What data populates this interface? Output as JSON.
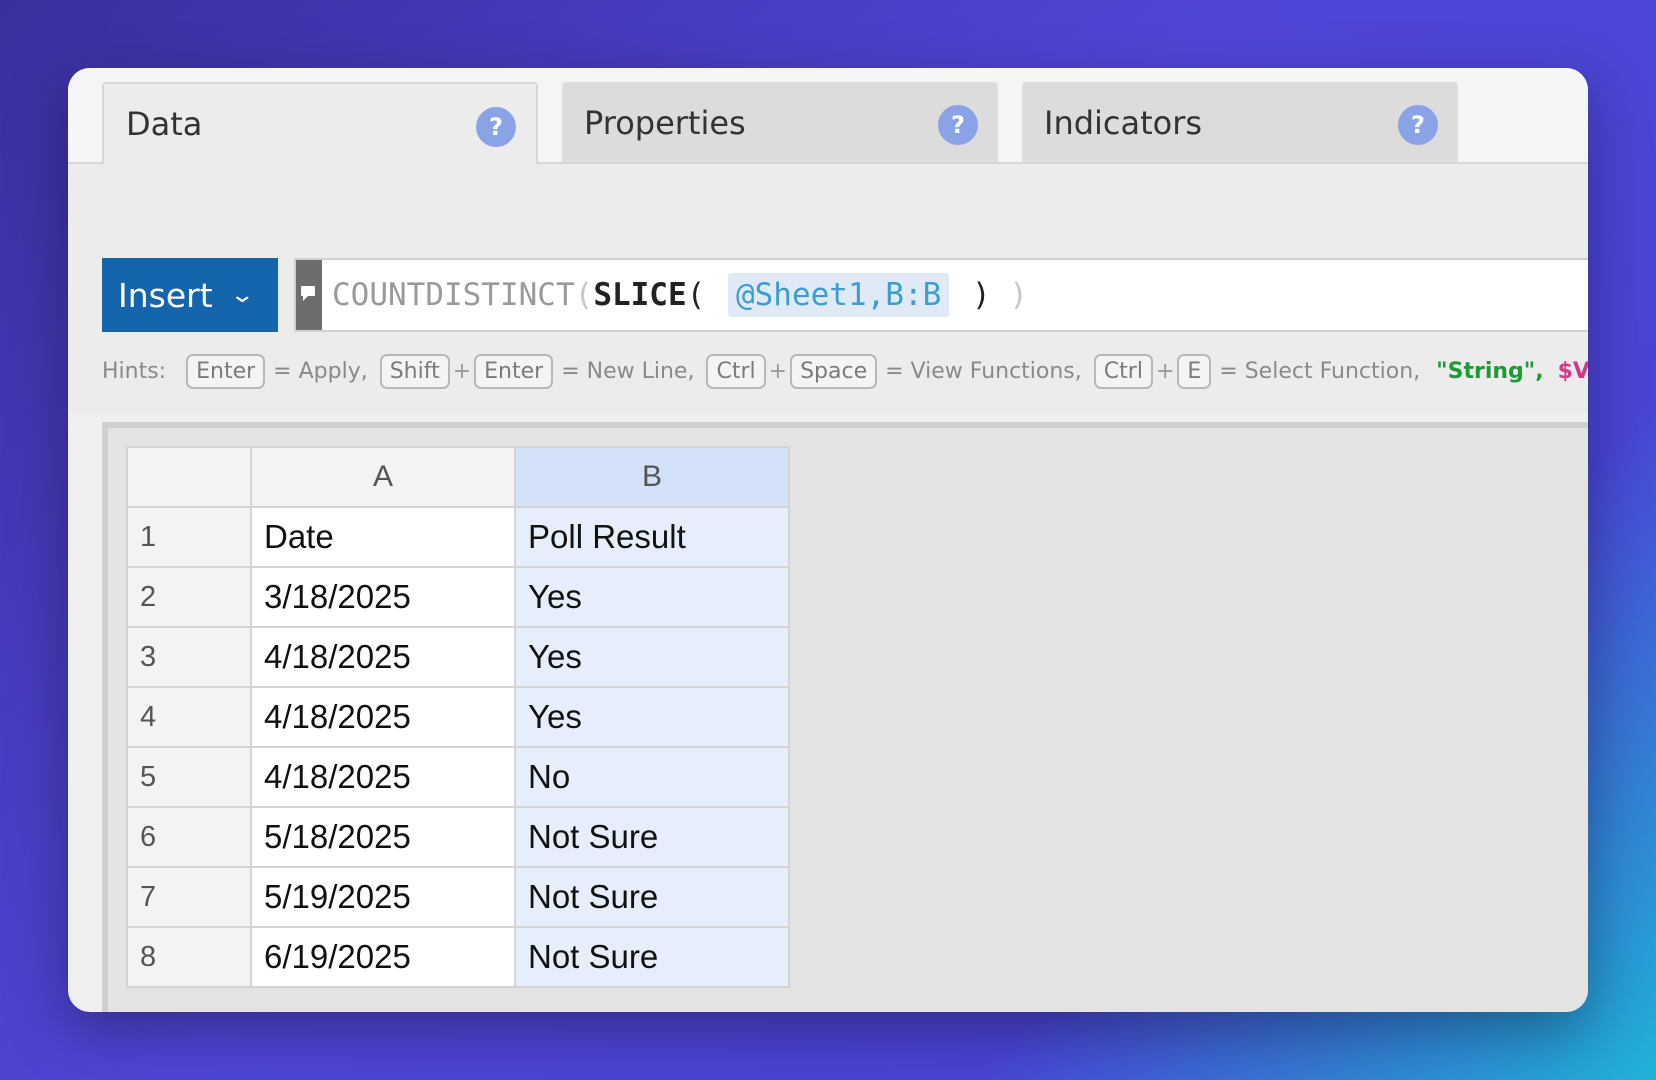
{
  "tabs": [
    {
      "label": "Data",
      "help": "?"
    },
    {
      "label": "Properties",
      "help": "?"
    },
    {
      "label": "Indicators",
      "help": "?"
    }
  ],
  "insert": {
    "label": "Insert",
    "chevron": "⌄"
  },
  "formula": {
    "fn_outer": "COUNTDISTINCT",
    "open1": "(",
    "fn_inner": "SLICE",
    "open2": "( ",
    "ref": "@Sheet1,B:B",
    "close2": " )",
    "close1": " )"
  },
  "hints": {
    "label": "Hints:",
    "keys": {
      "enter1": "Enter",
      "shift": "Shift",
      "enter2": "Enter",
      "ctrl1": "Ctrl",
      "space": "Space",
      "ctrl2": "Ctrl",
      "e": "E"
    },
    "plus": "+",
    "apply": "= Apply,",
    "new_line": "= New Line,",
    "view_functions": "= View Functions,",
    "select_function": "= Select Function,",
    "string": "\"String\",",
    "variable": "$Variable,"
  },
  "sheet": {
    "columns": [
      "A",
      "B"
    ],
    "rows": [
      {
        "num": "1",
        "a": "Date",
        "b": "Poll Result"
      },
      {
        "num": "2",
        "a": "3/18/2025",
        "b": "Yes"
      },
      {
        "num": "3",
        "a": "4/18/2025",
        "b": "Yes"
      },
      {
        "num": "4",
        "a": "4/18/2025",
        "b": "Yes"
      },
      {
        "num": "5",
        "a": "4/18/2025",
        "b": "No"
      },
      {
        "num": "6",
        "a": "5/18/2025",
        "b": "Not Sure"
      },
      {
        "num": "7",
        "a": "5/19/2025",
        "b": "Not Sure"
      },
      {
        "num": "8",
        "a": "6/19/2025",
        "b": "Not Sure"
      }
    ]
  }
}
